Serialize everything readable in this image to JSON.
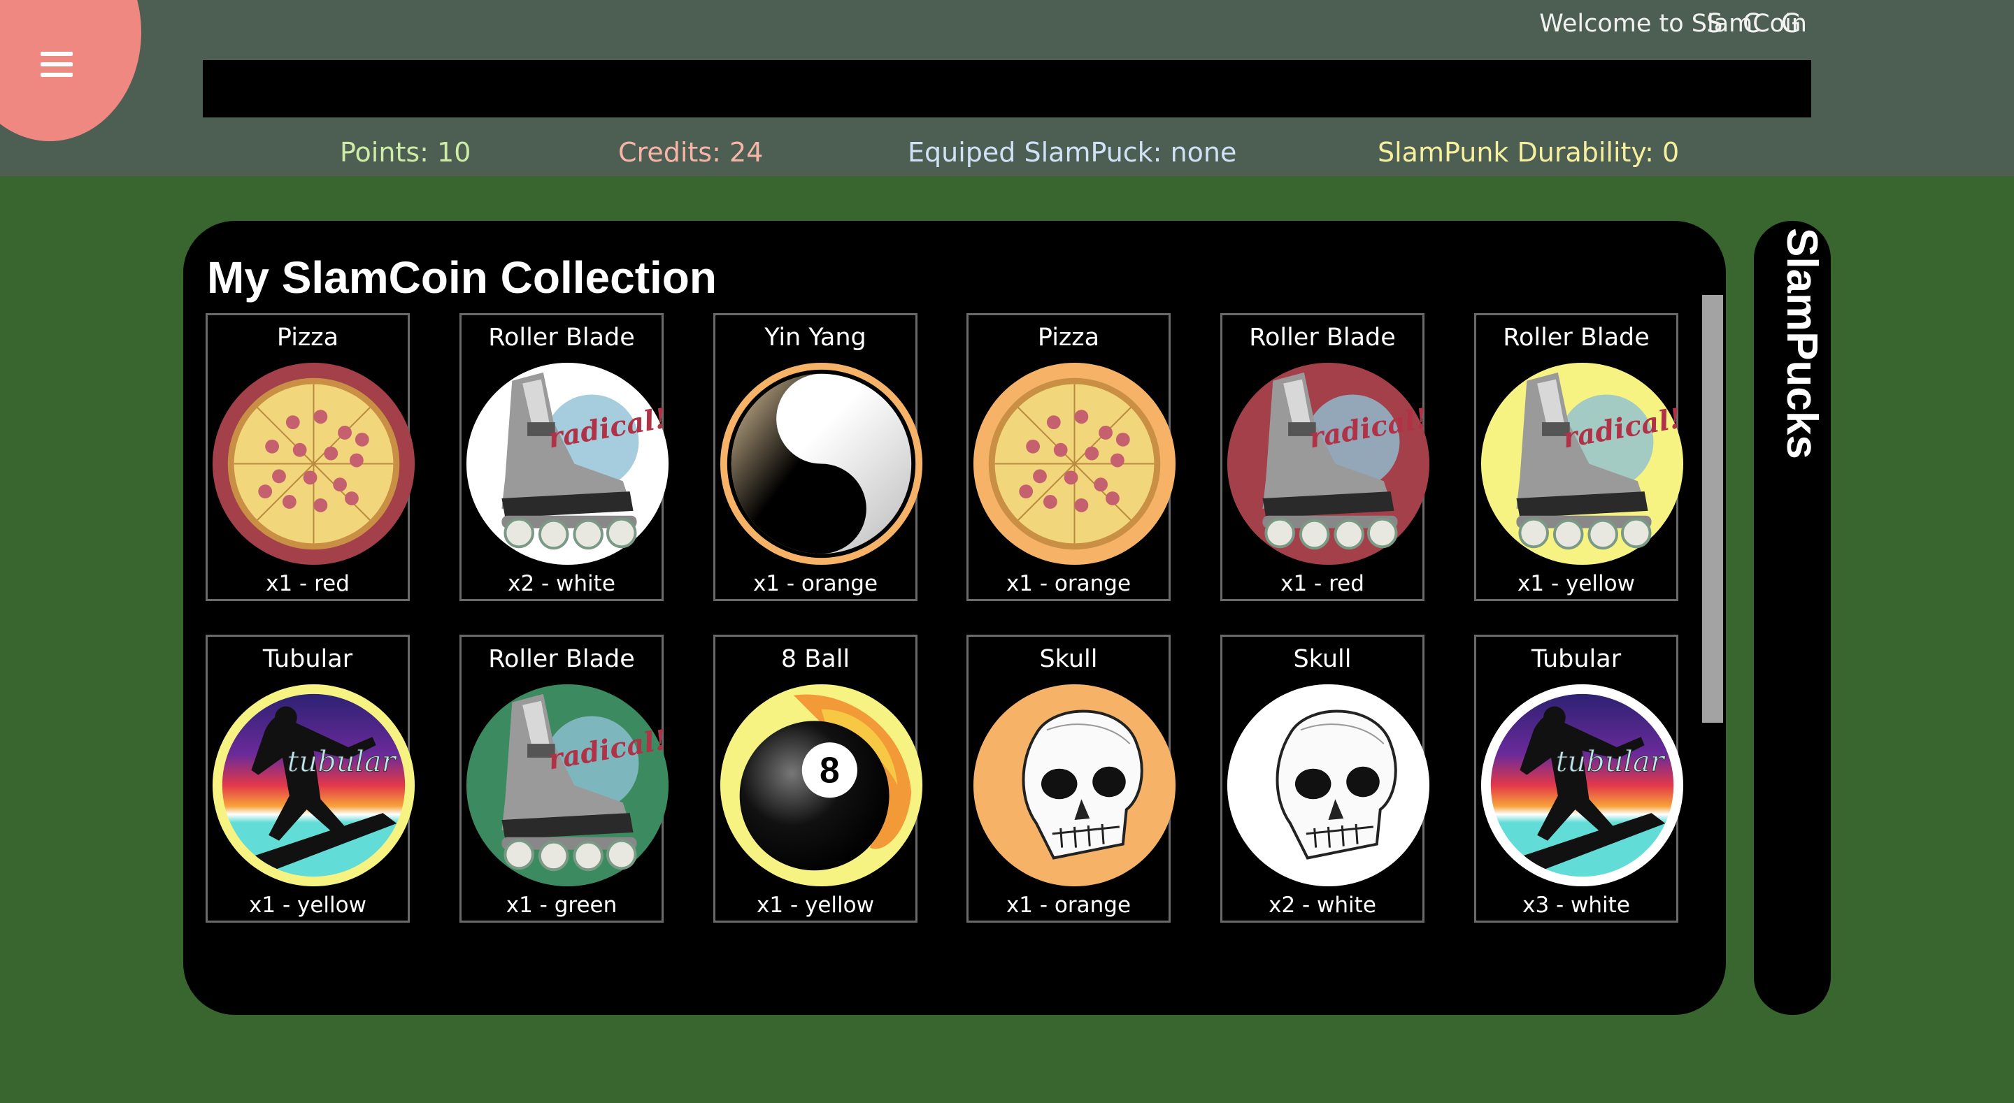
{
  "header": {
    "welcome": "Welcome to SlamCoin",
    "nav_letters": [
      "S",
      "C",
      "G"
    ]
  },
  "stats": {
    "points": "Points: 10",
    "credits": "Credits: 24",
    "equipped": "Equiped SlamPuck: none",
    "durability": "SlamPunk Durability: 0"
  },
  "colors": {
    "header_bg": "#4d5e52",
    "page_bg": "#39652f",
    "menu_blob": "#ef8880",
    "points_text": "#cdeca5",
    "credits_text": "#f6b5a7",
    "equipped_text": "#cfe2f6",
    "durability_text": "#f6efa0"
  },
  "collection": {
    "title": "My SlamCoin Collection",
    "coins": [
      {
        "name": "Pizza",
        "meta": "x1 - red",
        "design": "pizza",
        "bg": "#a3404a",
        "icon": "pizza-icon"
      },
      {
        "name": "Roller Blade",
        "meta": "x2 - white",
        "design": "roller",
        "bg": "#ffffff",
        "icon": "roller-blade-icon"
      },
      {
        "name": "Yin Yang",
        "meta": "x1 - orange",
        "design": "yinyang",
        "bg": "#f6b368",
        "icon": "yin-yang-icon"
      },
      {
        "name": "Pizza",
        "meta": "x1 - orange",
        "design": "pizza",
        "bg": "#f6b368",
        "icon": "pizza-icon"
      },
      {
        "name": "Roller Blade",
        "meta": "x1 - red",
        "design": "roller",
        "bg": "#a3404a",
        "icon": "roller-blade-icon"
      },
      {
        "name": "Roller Blade",
        "meta": "x1 - yellow",
        "design": "roller",
        "bg": "#f6f382",
        "icon": "roller-blade-icon"
      },
      {
        "name": "Tubular",
        "meta": "x1 - yellow",
        "design": "tubular",
        "bg": "#f6f382",
        "icon": "surfer-icon"
      },
      {
        "name": "Roller Blade",
        "meta": "x1 - green",
        "design": "roller",
        "bg": "#3c8a5f",
        "icon": "roller-blade-icon"
      },
      {
        "name": "8 Ball",
        "meta": "x1 - yellow",
        "design": "eightball",
        "bg": "#f6f382",
        "icon": "eight-ball-icon"
      },
      {
        "name": "Skull",
        "meta": "x1 - orange",
        "design": "skull",
        "bg": "#f6b368",
        "icon": "skull-icon"
      },
      {
        "name": "Skull",
        "meta": "x2 - white",
        "design": "skull",
        "bg": "#ffffff",
        "icon": "skull-icon"
      },
      {
        "name": "Tubular",
        "meta": "x3 - white",
        "design": "tubular",
        "bg": "#ffffff",
        "icon": "surfer-icon"
      }
    ]
  },
  "coin_text": {
    "radical": "radical!",
    "tubular": "tubular",
    "eight": "8"
  },
  "sidebar": {
    "label": "SlamPucks"
  }
}
